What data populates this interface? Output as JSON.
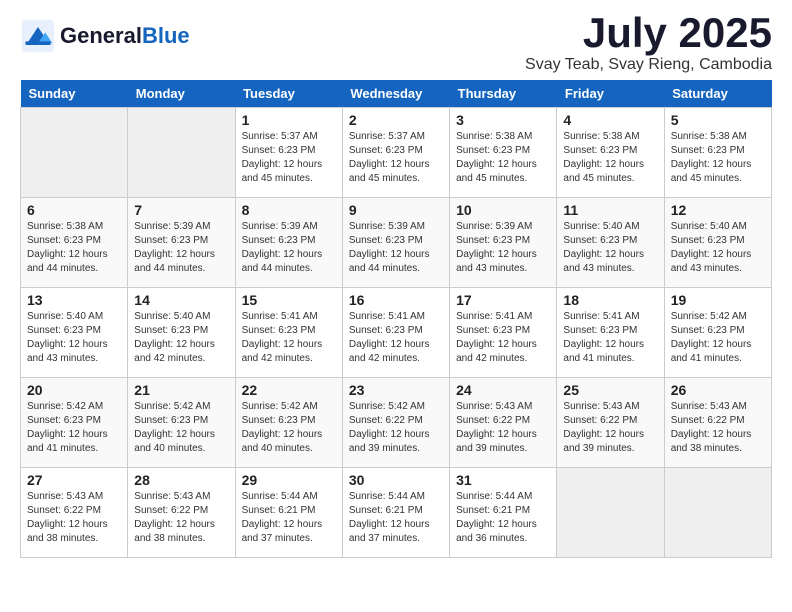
{
  "header": {
    "logo_text_general": "General",
    "logo_text_blue": "Blue",
    "month": "July 2025",
    "location": "Svay Teab, Svay Rieng, Cambodia"
  },
  "days_of_week": [
    "Sunday",
    "Monday",
    "Tuesday",
    "Wednesday",
    "Thursday",
    "Friday",
    "Saturday"
  ],
  "weeks": [
    [
      {
        "day": "",
        "empty": true
      },
      {
        "day": "",
        "empty": true
      },
      {
        "day": "1",
        "sunrise": "Sunrise: 5:37 AM",
        "sunset": "Sunset: 6:23 PM",
        "daylight": "Daylight: 12 hours and 45 minutes."
      },
      {
        "day": "2",
        "sunrise": "Sunrise: 5:37 AM",
        "sunset": "Sunset: 6:23 PM",
        "daylight": "Daylight: 12 hours and 45 minutes."
      },
      {
        "day": "3",
        "sunrise": "Sunrise: 5:38 AM",
        "sunset": "Sunset: 6:23 PM",
        "daylight": "Daylight: 12 hours and 45 minutes."
      },
      {
        "day": "4",
        "sunrise": "Sunrise: 5:38 AM",
        "sunset": "Sunset: 6:23 PM",
        "daylight": "Daylight: 12 hours and 45 minutes."
      },
      {
        "day": "5",
        "sunrise": "Sunrise: 5:38 AM",
        "sunset": "Sunset: 6:23 PM",
        "daylight": "Daylight: 12 hours and 45 minutes."
      }
    ],
    [
      {
        "day": "6",
        "sunrise": "Sunrise: 5:38 AM",
        "sunset": "Sunset: 6:23 PM",
        "daylight": "Daylight: 12 hours and 44 minutes."
      },
      {
        "day": "7",
        "sunrise": "Sunrise: 5:39 AM",
        "sunset": "Sunset: 6:23 PM",
        "daylight": "Daylight: 12 hours and 44 minutes."
      },
      {
        "day": "8",
        "sunrise": "Sunrise: 5:39 AM",
        "sunset": "Sunset: 6:23 PM",
        "daylight": "Daylight: 12 hours and 44 minutes."
      },
      {
        "day": "9",
        "sunrise": "Sunrise: 5:39 AM",
        "sunset": "Sunset: 6:23 PM",
        "daylight": "Daylight: 12 hours and 44 minutes."
      },
      {
        "day": "10",
        "sunrise": "Sunrise: 5:39 AM",
        "sunset": "Sunset: 6:23 PM",
        "daylight": "Daylight: 12 hours and 43 minutes."
      },
      {
        "day": "11",
        "sunrise": "Sunrise: 5:40 AM",
        "sunset": "Sunset: 6:23 PM",
        "daylight": "Daylight: 12 hours and 43 minutes."
      },
      {
        "day": "12",
        "sunrise": "Sunrise: 5:40 AM",
        "sunset": "Sunset: 6:23 PM",
        "daylight": "Daylight: 12 hours and 43 minutes."
      }
    ],
    [
      {
        "day": "13",
        "sunrise": "Sunrise: 5:40 AM",
        "sunset": "Sunset: 6:23 PM",
        "daylight": "Daylight: 12 hours and 43 minutes."
      },
      {
        "day": "14",
        "sunrise": "Sunrise: 5:40 AM",
        "sunset": "Sunset: 6:23 PM",
        "daylight": "Daylight: 12 hours and 42 minutes."
      },
      {
        "day": "15",
        "sunrise": "Sunrise: 5:41 AM",
        "sunset": "Sunset: 6:23 PM",
        "daylight": "Daylight: 12 hours and 42 minutes."
      },
      {
        "day": "16",
        "sunrise": "Sunrise: 5:41 AM",
        "sunset": "Sunset: 6:23 PM",
        "daylight": "Daylight: 12 hours and 42 minutes."
      },
      {
        "day": "17",
        "sunrise": "Sunrise: 5:41 AM",
        "sunset": "Sunset: 6:23 PM",
        "daylight": "Daylight: 12 hours and 42 minutes."
      },
      {
        "day": "18",
        "sunrise": "Sunrise: 5:41 AM",
        "sunset": "Sunset: 6:23 PM",
        "daylight": "Daylight: 12 hours and 41 minutes."
      },
      {
        "day": "19",
        "sunrise": "Sunrise: 5:42 AM",
        "sunset": "Sunset: 6:23 PM",
        "daylight": "Daylight: 12 hours and 41 minutes."
      }
    ],
    [
      {
        "day": "20",
        "sunrise": "Sunrise: 5:42 AM",
        "sunset": "Sunset: 6:23 PM",
        "daylight": "Daylight: 12 hours and 41 minutes."
      },
      {
        "day": "21",
        "sunrise": "Sunrise: 5:42 AM",
        "sunset": "Sunset: 6:23 PM",
        "daylight": "Daylight: 12 hours and 40 minutes."
      },
      {
        "day": "22",
        "sunrise": "Sunrise: 5:42 AM",
        "sunset": "Sunset: 6:23 PM",
        "daylight": "Daylight: 12 hours and 40 minutes."
      },
      {
        "day": "23",
        "sunrise": "Sunrise: 5:42 AM",
        "sunset": "Sunset: 6:22 PM",
        "daylight": "Daylight: 12 hours and 39 minutes."
      },
      {
        "day": "24",
        "sunrise": "Sunrise: 5:43 AM",
        "sunset": "Sunset: 6:22 PM",
        "daylight": "Daylight: 12 hours and 39 minutes."
      },
      {
        "day": "25",
        "sunrise": "Sunrise: 5:43 AM",
        "sunset": "Sunset: 6:22 PM",
        "daylight": "Daylight: 12 hours and 39 minutes."
      },
      {
        "day": "26",
        "sunrise": "Sunrise: 5:43 AM",
        "sunset": "Sunset: 6:22 PM",
        "daylight": "Daylight: 12 hours and 38 minutes."
      }
    ],
    [
      {
        "day": "27",
        "sunrise": "Sunrise: 5:43 AM",
        "sunset": "Sunset: 6:22 PM",
        "daylight": "Daylight: 12 hours and 38 minutes."
      },
      {
        "day": "28",
        "sunrise": "Sunrise: 5:43 AM",
        "sunset": "Sunset: 6:22 PM",
        "daylight": "Daylight: 12 hours and 38 minutes."
      },
      {
        "day": "29",
        "sunrise": "Sunrise: 5:44 AM",
        "sunset": "Sunset: 6:21 PM",
        "daylight": "Daylight: 12 hours and 37 minutes."
      },
      {
        "day": "30",
        "sunrise": "Sunrise: 5:44 AM",
        "sunset": "Sunset: 6:21 PM",
        "daylight": "Daylight: 12 hours and 37 minutes."
      },
      {
        "day": "31",
        "sunrise": "Sunrise: 5:44 AM",
        "sunset": "Sunset: 6:21 PM",
        "daylight": "Daylight: 12 hours and 36 minutes."
      },
      {
        "day": "",
        "empty": true
      },
      {
        "day": "",
        "empty": true
      }
    ]
  ]
}
